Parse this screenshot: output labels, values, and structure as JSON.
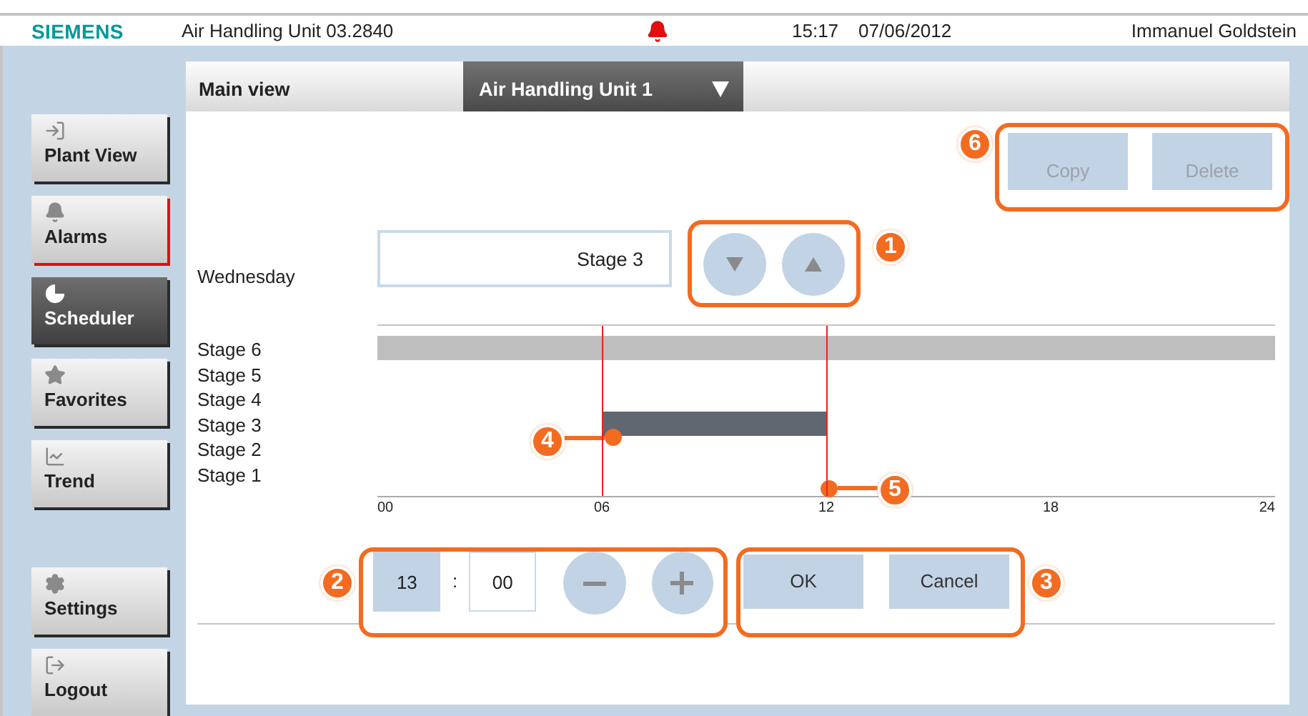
{
  "header": {
    "logo": "SIEMENS",
    "title": "Air Handling Unit 03.2840",
    "time": "15:17",
    "date": "07/06/2012",
    "user": "Immanuel Goldstein"
  },
  "sidebar": {
    "items": [
      {
        "label": "Plant View",
        "selected": false,
        "alert": false
      },
      {
        "label": "Alarms",
        "selected": false,
        "alert": true
      },
      {
        "label": "Scheduler",
        "selected": true,
        "alert": false
      },
      {
        "label": "Favorites",
        "selected": false,
        "alert": false
      },
      {
        "label": "Trend",
        "selected": false,
        "alert": false
      }
    ],
    "bottom_items": [
      {
        "label": "Settings",
        "selected": false,
        "alert": false
      },
      {
        "label": "Logout",
        "selected": false,
        "alert": false
      }
    ]
  },
  "tab_bar": {
    "title": "Main view",
    "dropdown": {
      "value": "Air Handling Unit 1"
    }
  },
  "actions": {
    "callout": "6",
    "buttons": [
      {
        "label": "Copy",
        "disabled": true
      },
      {
        "label": "Delete",
        "disabled": true
      }
    ]
  },
  "stage_selector": {
    "day": "Wednesday",
    "value": "Stage 3",
    "callout": "1"
  },
  "schedule": {
    "start_marker": {
      "level": 0.25,
      "callout": "4"
    },
    "end_marker": {
      "level": 0.5,
      "callout": "5"
    },
    "stages": [
      {
        "label": "Stage 6",
        "period": {
          "level": 1,
          "selected": false
        }
      },
      {
        "label": "Stage 5"
      },
      {
        "label": "Stage 4"
      },
      {
        "label": "Stage 3",
        "period": {
          "selected": true
        }
      },
      {
        "label": "Stage 2"
      },
      {
        "label": "Stage 1"
      }
    ],
    "ticks": [
      "00",
      "06",
      "12",
      "18",
      "24"
    ]
  },
  "time_editor": {
    "callout": "2",
    "hour": "13",
    "separator": ":",
    "minute": "00"
  },
  "confirm": {
    "callout": "3",
    "buttons": [
      "OK",
      "Cancel"
    ]
  }
}
